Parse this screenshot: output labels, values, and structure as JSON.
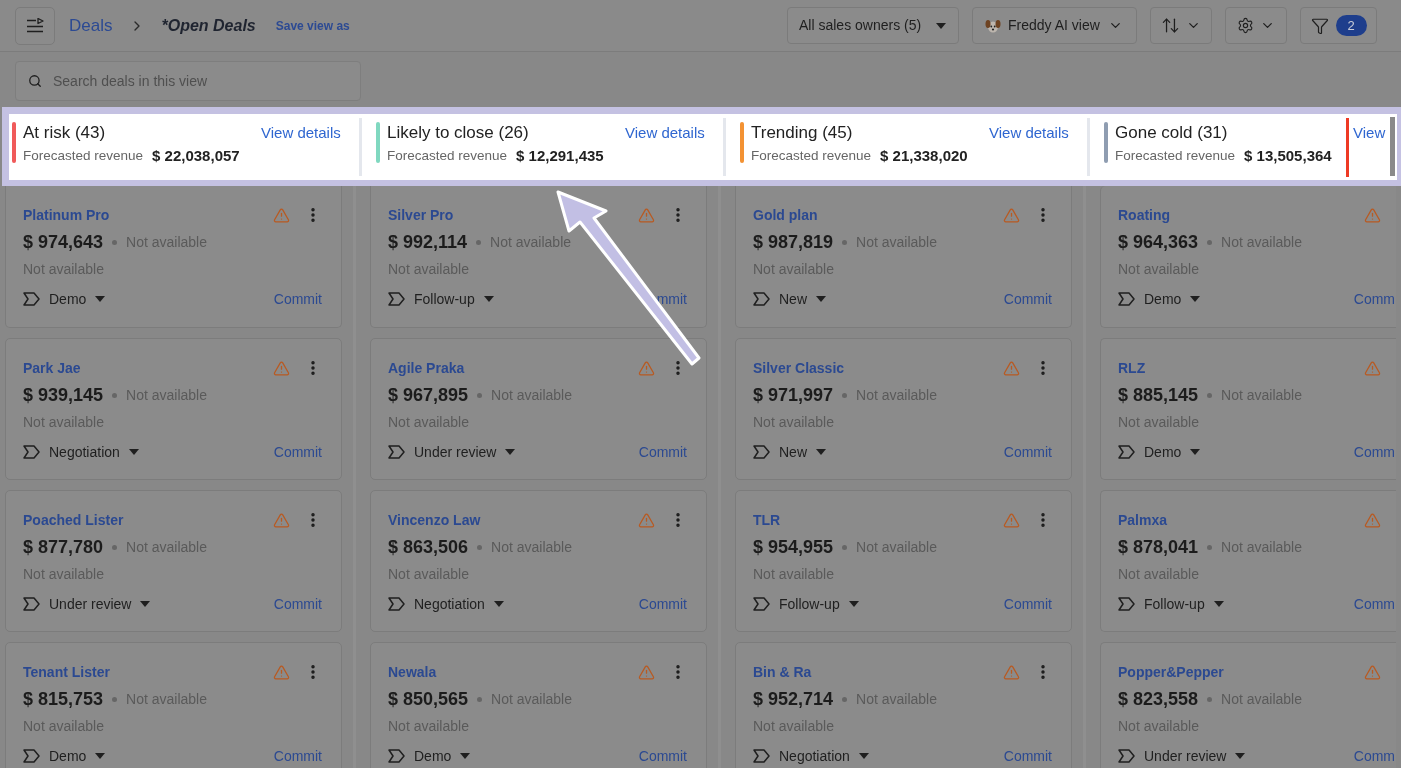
{
  "header": {
    "crumb": "Deals",
    "view_title": "*Open Deals",
    "save_link": "Save view as"
  },
  "toolbar": {
    "owner_filter": "All sales owners (5)",
    "ai_view": "Freddy AI view",
    "filter_count": "2"
  },
  "search": {
    "placeholder": "Search deals in this view"
  },
  "summary": [
    {
      "title": "At risk (43)",
      "link": "View details",
      "label": "Forecasted revenue",
      "value": "$ 22,038,057",
      "color": "#f05a5a"
    },
    {
      "title": "Likely to close (26)",
      "link": "View details",
      "label": "Forecasted revenue",
      "value": "$ 12,291,435",
      "color": "#80d8c0"
    },
    {
      "title": "Trending (45)",
      "link": "View details",
      "label": "Forecasted revenue",
      "value": "$ 21,338,020",
      "color": "#f39233"
    },
    {
      "title": "Gone cold (31)",
      "link": "View",
      "label": "Forecasted revenue",
      "value": "$ 13,505,364",
      "color": "#8f9db1"
    }
  ],
  "board": {
    "columns": [
      {
        "cards": [
          {
            "name": "Platinum Pro",
            "amount": "$ 974,643",
            "status": "Not available",
            "detail": "Not available",
            "stage": "Demo",
            "action": "Commit"
          },
          {
            "name": "Park Jae",
            "amount": "$ 939,145",
            "status": "Not available",
            "detail": "Not available",
            "stage": "Negotiation",
            "action": "Commit"
          },
          {
            "name": "Poached Lister",
            "amount": "$ 877,780",
            "status": "Not available",
            "detail": "Not available",
            "stage": "Under review",
            "action": "Commit"
          },
          {
            "name": "Tenant Lister",
            "amount": "$ 815,753",
            "status": "Not available",
            "detail": "Not available",
            "stage": "Demo",
            "action": "Commit"
          }
        ]
      },
      {
        "cards": [
          {
            "name": "Silver Pro",
            "amount": "$ 992,114",
            "status": "Not available",
            "detail": "Not available",
            "stage": "Follow-up",
            "action": "mmit"
          },
          {
            "name": "Agile Praka",
            "amount": "$ 967,895",
            "status": "Not available",
            "detail": "Not available",
            "stage": "Under review",
            "action": "Commit"
          },
          {
            "name": "Vincenzo Law",
            "amount": "$ 863,506",
            "status": "Not available",
            "detail": "Not available",
            "stage": "Negotiation",
            "action": "Commit"
          },
          {
            "name": "Newala",
            "amount": "$ 850,565",
            "status": "Not available",
            "detail": "Not available",
            "stage": "Demo",
            "action": "Commit"
          }
        ]
      },
      {
        "cards": [
          {
            "name": "Gold plan",
            "amount": "$ 987,819",
            "status": "Not available",
            "detail": "Not available",
            "stage": "New",
            "action": "Commit"
          },
          {
            "name": "Silver Classic",
            "amount": "$ 971,997",
            "status": "Not available",
            "detail": "Not available",
            "stage": "New",
            "action": "Commit"
          },
          {
            "name": "TLR",
            "amount": "$ 954,955",
            "status": "Not available",
            "detail": "Not available",
            "stage": "Follow-up",
            "action": "Commit"
          },
          {
            "name": "Bin & Ra",
            "amount": "$ 952,714",
            "status": "Not available",
            "detail": "Not available",
            "stage": "Negotiation",
            "action": "Commit"
          }
        ]
      },
      {
        "cards": [
          {
            "name": "Roating",
            "amount": "$ 964,363",
            "status": "Not available",
            "detail": "Not available",
            "stage": "Demo",
            "action": "Comm"
          },
          {
            "name": "RLZ",
            "amount": "$ 885,145",
            "status": "Not available",
            "detail": "Not available",
            "stage": "Demo",
            "action": "Comm"
          },
          {
            "name": "Palmxa",
            "amount": "$ 878,041",
            "status": "Not available",
            "detail": "Not available",
            "stage": "Follow-up",
            "action": "Comm"
          },
          {
            "name": "Popper&Pepper",
            "amount": "$ 823,558",
            "status": "Not available",
            "detail": "Not available",
            "stage": "Under review",
            "action": "Comm"
          }
        ]
      }
    ]
  }
}
